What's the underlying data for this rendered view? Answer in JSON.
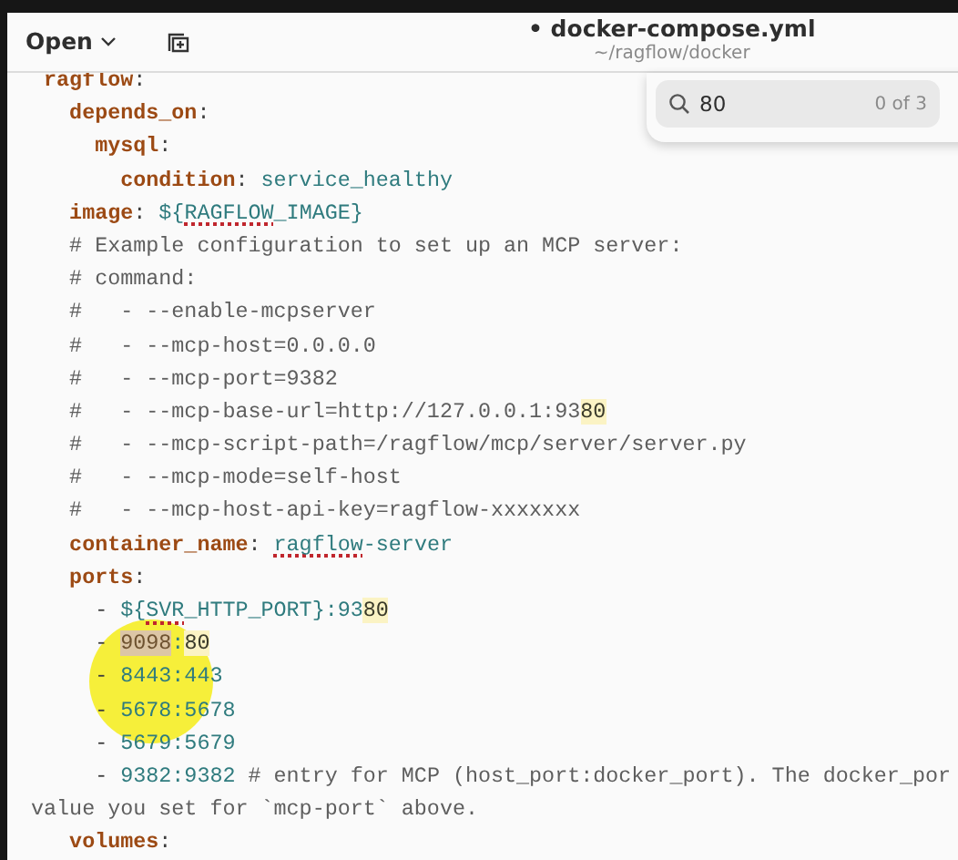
{
  "header": {
    "open_button": "Open",
    "title": "• docker-compose.yml",
    "subtitle": "~/ragflow/docker"
  },
  "search": {
    "value": "80",
    "count": "0 of 3"
  },
  "pointer_highlight": true,
  "lines": [
    {
      "segments": [
        {
          "text": "  ragflow",
          "kind": "key"
        },
        {
          "text": ":",
          "kind": "plain"
        }
      ]
    },
    {
      "segments": [
        {
          "text": "    depends_on",
          "kind": "key"
        },
        {
          "text": ":",
          "kind": "plain"
        }
      ]
    },
    {
      "segments": [
        {
          "text": "      mysql",
          "kind": "key"
        },
        {
          "text": ":",
          "kind": "plain"
        }
      ]
    },
    {
      "segments": [
        {
          "text": "        condition",
          "kind": "key"
        },
        {
          "text": ": ",
          "kind": "plain"
        },
        {
          "text": "service_healthy",
          "kind": "value"
        }
      ]
    },
    {
      "segments": [
        {
          "text": "    image",
          "kind": "key"
        },
        {
          "text": ": ",
          "kind": "plain"
        },
        {
          "text": "${",
          "kind": "value"
        },
        {
          "text": "RAGFLOW",
          "kind": "value",
          "misspelled": true
        },
        {
          "text": "_IMAGE}",
          "kind": "value"
        }
      ]
    },
    {
      "segments": [
        {
          "text": "    # Example configuration to set up an MCP server:",
          "kind": "comment"
        }
      ]
    },
    {
      "segments": [
        {
          "text": "    # command:",
          "kind": "comment"
        }
      ]
    },
    {
      "segments": [
        {
          "text": "    #   - --enable-mcpserver",
          "kind": "comment"
        }
      ]
    },
    {
      "segments": [
        {
          "text": "    #   - --mcp-host=0.0.0.0",
          "kind": "comment"
        }
      ]
    },
    {
      "segments": [
        {
          "text": "    #   - --mcp-port=9382",
          "kind": "comment"
        }
      ]
    },
    {
      "segments": [
        {
          "text": "    #   - --mcp-base-url=http://127.0.0.1:93",
          "kind": "comment"
        },
        {
          "text": "80",
          "kind": "comment",
          "match": true
        }
      ]
    },
    {
      "segments": [
        {
          "text": "    #   - --mcp-script-path=/ragflow/mcp/server/server.py",
          "kind": "comment"
        }
      ]
    },
    {
      "segments": [
        {
          "text": "    #   - --mcp-mode=self-host",
          "kind": "comment"
        }
      ]
    },
    {
      "segments": [
        {
          "text": "    #   - --mcp-host-api-key=ragflow-xxxxxxx",
          "kind": "comment"
        }
      ]
    },
    {
      "segments": [
        {
          "text": "    container_name",
          "kind": "key"
        },
        {
          "text": ": ",
          "kind": "plain"
        },
        {
          "text": "ragflow",
          "kind": "value",
          "misspelled": true
        },
        {
          "text": "-server",
          "kind": "value"
        }
      ]
    },
    {
      "segments": [
        {
          "text": "    ports",
          "kind": "key"
        },
        {
          "text": ":",
          "kind": "plain"
        }
      ]
    },
    {
      "segments": [
        {
          "text": "      - ",
          "kind": "plain"
        },
        {
          "text": "${",
          "kind": "value"
        },
        {
          "text": "SVR",
          "kind": "value",
          "misspelled": true
        },
        {
          "text": "_HTTP_PORT}:93",
          "kind": "value"
        },
        {
          "text": "80",
          "kind": "value",
          "match": true
        }
      ]
    },
    {
      "segments": [
        {
          "text": "      - ",
          "kind": "plain"
        },
        {
          "text": "9098",
          "kind": "value",
          "selected": true
        },
        {
          "text": ":",
          "kind": "value"
        },
        {
          "text": "80",
          "kind": "value",
          "match": true
        }
      ]
    },
    {
      "segments": [
        {
          "text": "      - ",
          "kind": "plain"
        },
        {
          "text": "8443:443",
          "kind": "value"
        }
      ]
    },
    {
      "segments": [
        {
          "text": "      - ",
          "kind": "plain"
        },
        {
          "text": "5678:5678",
          "kind": "value"
        }
      ]
    },
    {
      "segments": [
        {
          "text": "      - ",
          "kind": "plain"
        },
        {
          "text": "5679:5679",
          "kind": "value"
        }
      ]
    },
    {
      "segments": [
        {
          "text": "      - ",
          "kind": "plain"
        },
        {
          "text": "9382:9382",
          "kind": "value"
        },
        {
          "text": " # entry for MCP (host_port:docker_port). The docker_por",
          "kind": "comment"
        }
      ]
    },
    {
      "segments": [
        {
          "text": " value you set for `mcp-port` above.",
          "kind": "comment"
        }
      ]
    },
    {
      "segments": [
        {
          "text": "    volumes",
          "kind": "key"
        },
        {
          "text": ":",
          "kind": "plain"
        }
      ]
    }
  ]
}
